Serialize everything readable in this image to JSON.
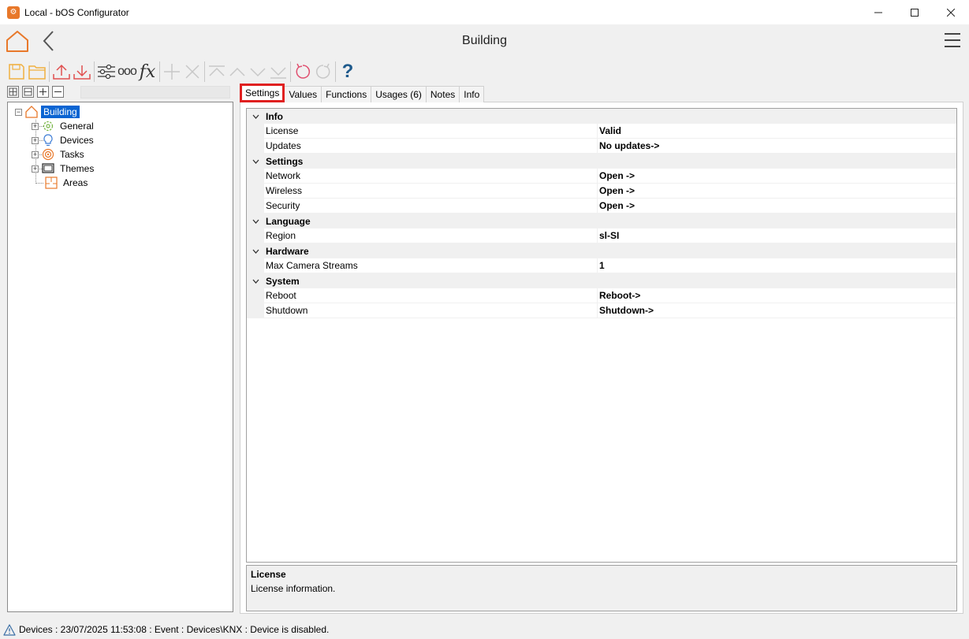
{
  "window": {
    "title": "Local - bOS Configurator",
    "app_icon_glyph": "⚙"
  },
  "header": {
    "title": "Building"
  },
  "toolbar": {
    "fx_label": "fx",
    "dots_label": "ooo",
    "help_label": "?"
  },
  "tree": {
    "items": [
      {
        "label": "Building",
        "icon": "home-icon"
      },
      {
        "label": "General",
        "icon": "gear-icon"
      },
      {
        "label": "Devices",
        "icon": "lightbulb-icon"
      },
      {
        "label": "Tasks",
        "icon": "target-icon"
      },
      {
        "label": "Themes",
        "icon": "monitor-icon"
      },
      {
        "label": "Areas",
        "icon": "floorplan-icon"
      }
    ]
  },
  "tabs": [
    {
      "label": "Settings"
    },
    {
      "label": "Values"
    },
    {
      "label": "Functions"
    },
    {
      "label": "Usages (6)"
    },
    {
      "label": "Notes"
    },
    {
      "label": "Info"
    }
  ],
  "grid": {
    "categories": [
      {
        "label": "Info",
        "rows": [
          {
            "name": "License",
            "value": "Valid"
          },
          {
            "name": "Updates",
            "value": "No updates->"
          }
        ]
      },
      {
        "label": "Settings",
        "rows": [
          {
            "name": "Network",
            "value": "Open ->"
          },
          {
            "name": "Wireless",
            "value": "Open ->"
          },
          {
            "name": "Security",
            "value": "Open ->"
          }
        ]
      },
      {
        "label": "Language",
        "rows": [
          {
            "name": "Region",
            "value": "sl-SI"
          }
        ]
      },
      {
        "label": "Hardware",
        "rows": [
          {
            "name": "Max Camera Streams",
            "value": "1"
          }
        ]
      },
      {
        "label": "System",
        "rows": [
          {
            "name": "Reboot",
            "value": "Reboot->"
          },
          {
            "name": "Shutdown",
            "value": "Shutdown->"
          }
        ]
      }
    ]
  },
  "description": {
    "title": "License",
    "text": "License information."
  },
  "status": {
    "text": "Devices : 23/07/2025 11:53:08 : Event : Devices\\KNX : Device is disabled."
  },
  "colors": {
    "accent_orange": "#e8782a",
    "selection_blue": "#0a64d2",
    "highlight_red": "#e02020"
  }
}
